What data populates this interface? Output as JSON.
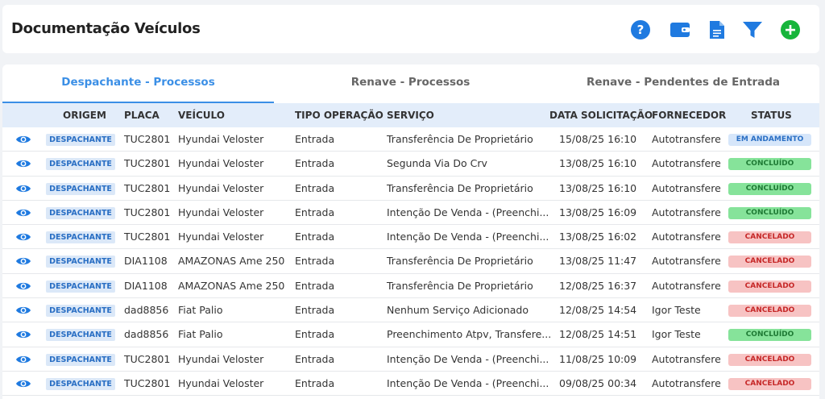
{
  "header": {
    "title": "Documentação Veículos",
    "icons": [
      {
        "name": "help-icon",
        "color": "#1f7ae0"
      },
      {
        "name": "wallet-icon",
        "color": "#1f7ae0"
      },
      {
        "name": "document-icon",
        "color": "#1f7ae0"
      },
      {
        "name": "filter-icon",
        "color": "#1f7ae0"
      },
      {
        "name": "add-icon",
        "color": "#17b53b"
      }
    ]
  },
  "tabs": [
    {
      "label": "Despachante - Processos",
      "active": true
    },
    {
      "label": "Renave - Processos",
      "active": false
    },
    {
      "label": "Renave - Pendentes de Entrada",
      "active": false
    }
  ],
  "table": {
    "columns": {
      "origem": "ORIGEM",
      "placa": "PLACA",
      "veiculo": "VEÍCULO",
      "tipo": "TIPO OPERAÇÃO",
      "servico": "SERVIÇO",
      "data": "DATA SOLICITAÇÃO",
      "fornecedor": "FORNECEDOR",
      "status": "STATUS"
    },
    "rows": [
      {
        "origem": "DESPACHANTE",
        "placa": "TUC2801",
        "veiculo": "Hyundai Veloster",
        "tipo": "Entrada",
        "servico": "Transferência De Proprietário",
        "data": "15/08/25 16:10",
        "fornecedor": "Autotransfere",
        "status": "EM ANDAMENTO",
        "status_type": "andamento"
      },
      {
        "origem": "DESPACHANTE",
        "placa": "TUC2801",
        "veiculo": "Hyundai Veloster",
        "tipo": "Entrada",
        "servico": "Segunda Via Do Crv",
        "data": "13/08/25 16:10",
        "fornecedor": "Autotransfere",
        "status": "CONCLUÍDO",
        "status_type": "concluido"
      },
      {
        "origem": "DESPACHANTE",
        "placa": "TUC2801",
        "veiculo": "Hyundai Veloster",
        "tipo": "Entrada",
        "servico": "Transferência De Proprietário",
        "data": "13/08/25 16:10",
        "fornecedor": "Autotransfere",
        "status": "CONCLUÍDO",
        "status_type": "concluido"
      },
      {
        "origem": "DESPACHANTE",
        "placa": "TUC2801",
        "veiculo": "Hyundai Veloster",
        "tipo": "Entrada",
        "servico": "Intenção De Venda - (Preenchi...",
        "data": "13/08/25 16:09",
        "fornecedor": "Autotransfere",
        "status": "CONCLUÍDO",
        "status_type": "concluido"
      },
      {
        "origem": "DESPACHANTE",
        "placa": "TUC2801",
        "veiculo": "Hyundai Veloster",
        "tipo": "Entrada",
        "servico": "Intenção De Venda - (Preenchi...",
        "data": "13/08/25 16:02",
        "fornecedor": "Autotransfere",
        "status": "CANCELADO",
        "status_type": "cancelado"
      },
      {
        "origem": "DESPACHANTE",
        "placa": "DIA1108",
        "veiculo": "AMAZONAS Ame 250",
        "tipo": "Entrada",
        "servico": "Transferência De Proprietário",
        "data": "13/08/25 11:47",
        "fornecedor": "Autotransfere",
        "status": "CANCELADO",
        "status_type": "cancelado"
      },
      {
        "origem": "DESPACHANTE",
        "placa": "DIA1108",
        "veiculo": "AMAZONAS Ame 250",
        "tipo": "Entrada",
        "servico": "Transferência De Proprietário",
        "data": "12/08/25 16:37",
        "fornecedor": "Autotransfere",
        "status": "CANCELADO",
        "status_type": "cancelado"
      },
      {
        "origem": "DESPACHANTE",
        "placa": "dad8856",
        "veiculo": "Fiat Palio",
        "tipo": "Entrada",
        "servico": "Nenhum Serviço Adicionado",
        "data": "12/08/25 14:54",
        "fornecedor": "Igor Teste",
        "status": "CANCELADO",
        "status_type": "cancelado"
      },
      {
        "origem": "DESPACHANTE",
        "placa": "dad8856",
        "veiculo": "Fiat Palio",
        "tipo": "Entrada",
        "servico": "Preenchimento Atpv, Transfere...",
        "data": "12/08/25 14:51",
        "fornecedor": "Igor Teste",
        "status": "CONCLUÍDO",
        "status_type": "concluido"
      },
      {
        "origem": "DESPACHANTE",
        "placa": "TUC2801",
        "veiculo": "Hyundai Veloster",
        "tipo": "Entrada",
        "servico": "Intenção De Venda - (Preenchi...",
        "data": "11/08/25 10:09",
        "fornecedor": "Autotransfere",
        "status": "CANCELADO",
        "status_type": "cancelado"
      },
      {
        "origem": "DESPACHANTE",
        "placa": "TUC2801",
        "veiculo": "Hyundai Veloster",
        "tipo": "Entrada",
        "servico": "Intenção De Venda - (Preenchi...",
        "data": "09/08/25 00:34",
        "fornecedor": "Autotransfere",
        "status": "CANCELADO",
        "status_type": "cancelado"
      }
    ]
  },
  "colors": {
    "accent": "#3b8fe6",
    "eye": "#1f7ae0",
    "header_bg": "#e3edfa"
  }
}
